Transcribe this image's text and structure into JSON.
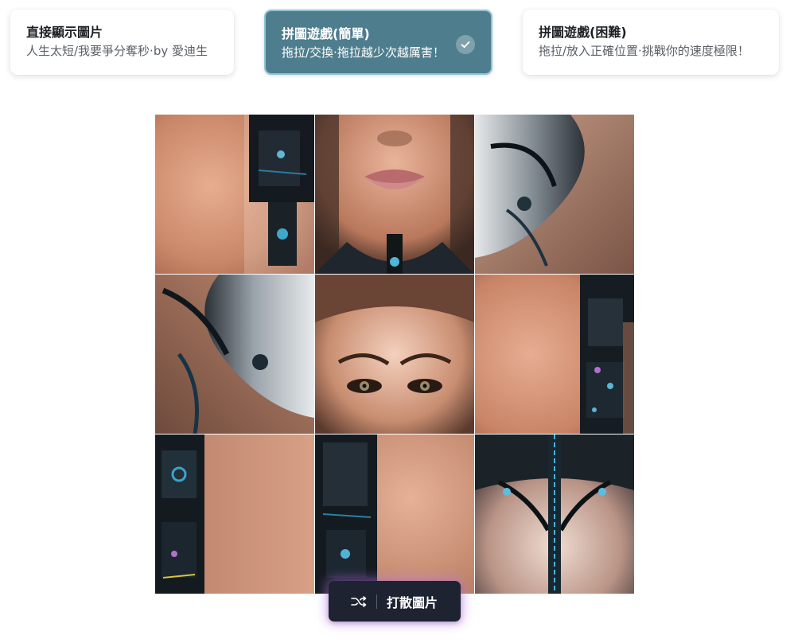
{
  "modes": [
    {
      "title": "直接顯示圖片",
      "desc": "人生太短/我要爭分奪秒·by 愛迪生",
      "selected": false
    },
    {
      "title": "拼圖遊戲(簡單)",
      "desc": "拖拉/交換·拖拉越少次越厲害！",
      "selected": true
    },
    {
      "title": "拼圖遊戲(困難)",
      "desc": "拖拉/放入正確位置·挑戰你的速度極限！",
      "selected": false
    }
  ],
  "puzzle": {
    "rows": 3,
    "cols": 3,
    "tiles": [
      {
        "piece": "skin-gradient-with-mechanical-column-right"
      },
      {
        "piece": "lips-and-chin-with-metal-collar"
      },
      {
        "piece": "chrome-shoulder-armor"
      },
      {
        "piece": "chrome-shoulder-armor-left"
      },
      {
        "piece": "eyes-and-forehead"
      },
      {
        "piece": "skin-gradient-with-mechanical-column-right"
      },
      {
        "piece": "mechanical-column-left"
      },
      {
        "piece": "mechanical-column-lower-left"
      },
      {
        "piece": "chest-with-cables"
      }
    ]
  },
  "shuffle_button": {
    "label": "打散圖片",
    "icon": "shuffle-icon"
  },
  "colors": {
    "active_card_bg": "#4e7d8d",
    "active_card_border": "#8fc4d4",
    "button_bg": "#1d2330",
    "button_glow": "#bc76eb"
  }
}
